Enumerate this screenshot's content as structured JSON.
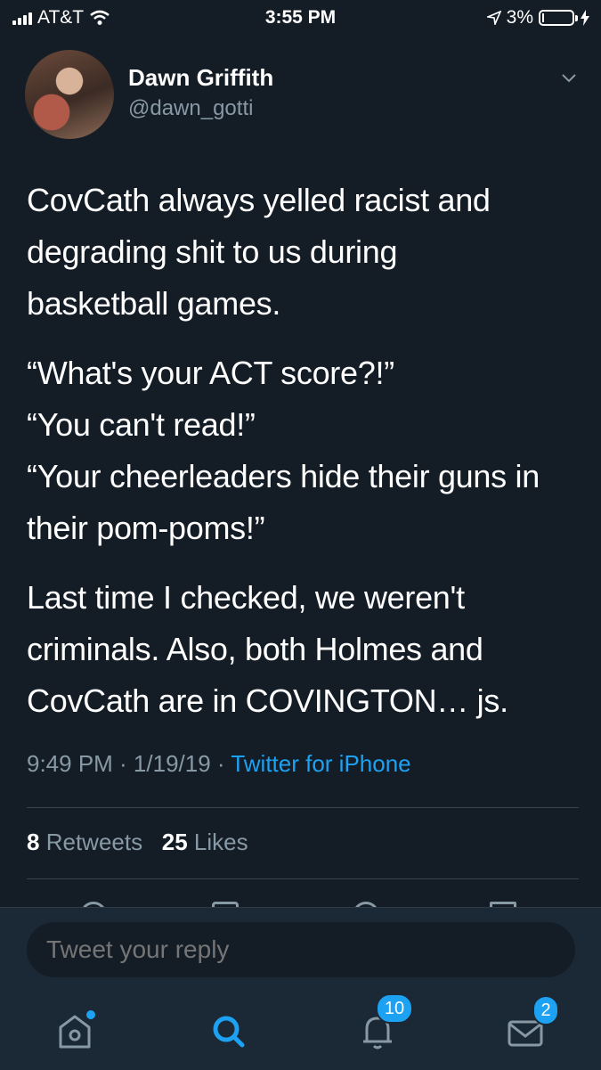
{
  "status_bar": {
    "carrier": "AT&T",
    "time": "3:55 PM",
    "battery_pct": "3%",
    "battery_level": 0.03
  },
  "tweet": {
    "author_name": "Dawn Griffith",
    "author_handle": "@dawn_gotti",
    "paragraphs": [
      [
        "CovCath always yelled racist and",
        "degrading shit to us during",
        "basketball games."
      ],
      [
        "“What's your ACT score?!”",
        "“You can't read!”",
        "“Your cheerleaders hide their guns in",
        "their pom-poms!”"
      ],
      [
        "Last time I checked, we weren't",
        "criminals. Also, both Holmes and",
        "CovCath are in COVINGTON… js."
      ]
    ],
    "timestamp": "9:49 PM · 1/19/19 ·",
    "source": "Twitter for iPhone",
    "retweets_count": "8",
    "retweets_label": "Retweets",
    "likes_count": "25",
    "likes_label": "Likes"
  },
  "reply": {
    "placeholder": "Tweet your reply"
  },
  "tab_bar": {
    "notifications_badge": "10",
    "messages_badge": "2"
  },
  "icons": [
    "wifi-icon",
    "location-arrow-icon",
    "battery-icon",
    "charging-bolt-icon",
    "chevron-down-icon",
    "home-icon",
    "search-icon",
    "bell-icon",
    "mail-icon"
  ],
  "colors": {
    "background": "#141d26",
    "accent": "#1da1f2",
    "secondary_text": "#8899a6"
  }
}
